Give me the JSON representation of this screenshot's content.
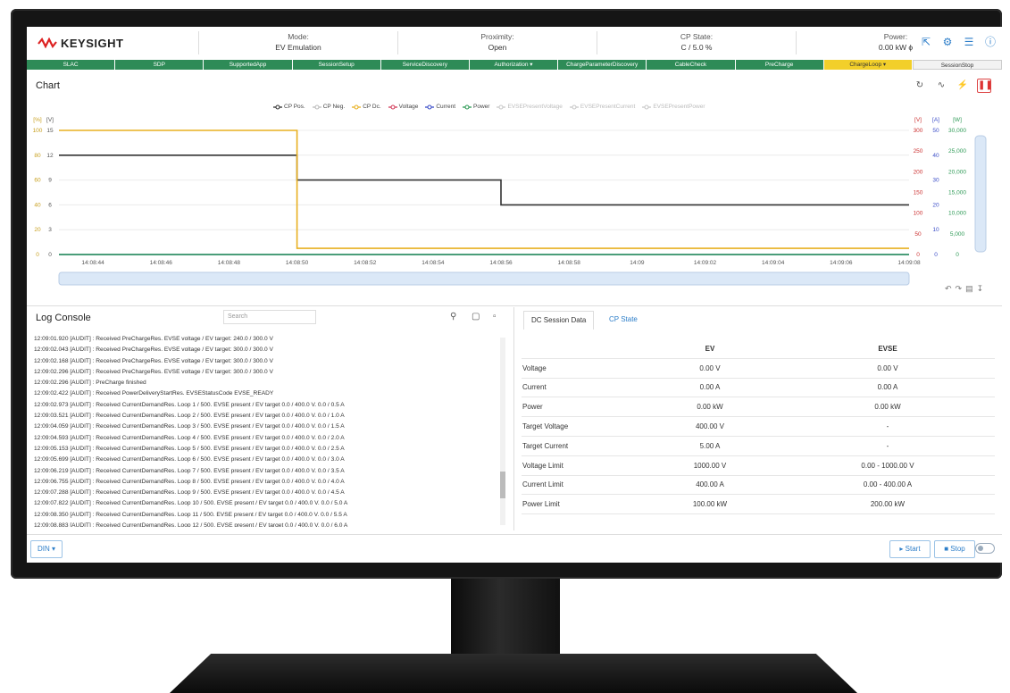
{
  "header": {
    "logo": "KEYSIGHT",
    "mode_label": "Mode:",
    "mode_value": "EV Emulation",
    "proximity_label": "Proximity:",
    "proximity_value": "Open",
    "cp_label": "CP State:",
    "cp_value": "C / 5.0 %",
    "power_label": "Power:",
    "power_value": "0.00 kW ϕ"
  },
  "steps": [
    "SLAC",
    "SDP",
    "SupportedApp",
    "SessionSetup",
    "ServiceDiscovery",
    "Authorization ▾",
    "ChargeParameterDiscovery",
    "CableCheck",
    "PreCharge",
    "ChargeLoop ▾",
    "SessionStop"
  ],
  "chart_panel": {
    "title": "Chart"
  },
  "chart_data": {
    "type": "line",
    "legend": [
      "CP Pos.",
      "CP Neg.",
      "CP Dc.",
      "Voltage",
      "Current",
      "Power",
      "EVSEPresentVoltage",
      "EVSEPresentCurrent",
      "EVSEPresentPower"
    ],
    "legend_colors": [
      "#333333",
      "#bbbbbb",
      "#e8b020",
      "#d23c5a",
      "#3c4ec8",
      "#2e9a56",
      "#c8c8c8",
      "#c8c8c8",
      "#c8c8c8"
    ],
    "left_axis_pct": [
      "100",
      "80",
      "60",
      "40",
      "20",
      "0"
    ],
    "left_axis_v": [
      "15",
      "12",
      "9",
      "6",
      "3",
      "0"
    ],
    "right_axis_v": [
      "300",
      "250",
      "200",
      "150",
      "100",
      "50",
      "0"
    ],
    "right_axis_a": [
      "50",
      "40",
      "30",
      "20",
      "10",
      "0"
    ],
    "right_axis_w": [
      "30,000",
      "25,000",
      "20,000",
      "15,000",
      "10,000",
      "5,000",
      "0"
    ],
    "axis_units": {
      "pct": "[%]",
      "v": "[V]",
      "v2": "[V]",
      "a": "[A]",
      "w": "[W]"
    },
    "x_ticks": [
      "14:08:44",
      "14:08:46",
      "14:08:48",
      "14:08:50",
      "14:08:52",
      "14:08:54",
      "14:08:56",
      "14:08:58",
      "14:09",
      "14:09:02",
      "14:09:04",
      "14:09:06",
      "14:09:08"
    ],
    "xlim": [
      "14:08:43",
      "14:09:08"
    ],
    "series": [
      {
        "name": "CP Pos.",
        "color": "#333333",
        "x": [
          "14:08:43",
          "14:08:50",
          "14:08:50",
          "14:08:56",
          "14:08:56",
          "14:09:08"
        ],
        "y": [
          12,
          12,
          9,
          9,
          6,
          6
        ]
      },
      {
        "name": "CP Dc.",
        "color": "#e8b020",
        "x": [
          "14:08:43",
          "14:08:50",
          "14:08:50",
          "14:09:08"
        ],
        "y": [
          100,
          100,
          5,
          5
        ]
      },
      {
        "name": "Current",
        "color": "#3c4ec8",
        "x": [
          "14:08:43",
          "14:09:08"
        ],
        "y": [
          0,
          0
        ]
      },
      {
        "name": "Power",
        "color": "#2e9a56",
        "x": [
          "14:08:43",
          "14:09:08"
        ],
        "y": [
          0,
          0
        ]
      }
    ]
  },
  "log": {
    "title": "Log Console",
    "search_placeholder": "Search",
    "lines": [
      "12:09:01.920 [AUDIT] : Received PreChargeRes. EVSE voltage / EV target: 240.0 / 300.0 V",
      "12:09:02.043 [AUDIT] : Received PreChargeRes. EVSE voltage / EV target: 300.0 / 300.0 V",
      "12:09:02.168 [AUDIT] : Received PreChargeRes. EVSE voltage / EV target: 300.0 / 300.0 V",
      "12:09:02.296 [AUDIT] : Received PreChargeRes. EVSE voltage / EV target: 300.0 / 300.0 V",
      "12:09:02.296 [AUDIT] : PreCharge finished",
      "12:09:02.422 [AUDIT] : Received PowerDeliveryStartRes. EVSEStatusCode EVSE_READY",
      "12:09:02.973 [AUDIT] : Received CurrentDemandRes. Loop 1 / 500. EVSE present / EV target 0.0 / 400.0 V. 0.0 / 0.5 A",
      "12:09:03.521 [AUDIT] : Received CurrentDemandRes. Loop 2 / 500. EVSE present / EV target 0.0 / 400.0 V. 0.0 / 1.0 A",
      "12:09:04.059 [AUDIT] : Received CurrentDemandRes. Loop 3 / 500. EVSE present / EV target 0.0 / 400.0 V. 0.0 / 1.5 A",
      "12:09:04.593 [AUDIT] : Received CurrentDemandRes. Loop 4 / 500. EVSE present / EV target 0.0 / 400.0 V. 0.0 / 2.0 A",
      "12:09:05.153 [AUDIT] : Received CurrentDemandRes. Loop 5 / 500. EVSE present / EV target 0.0 / 400.0 V. 0.0 / 2.5 A",
      "12:09:05.699 [AUDIT] : Received CurrentDemandRes. Loop 6 / 500. EVSE present / EV target 0.0 / 400.0 V. 0.0 / 3.0 A",
      "12:09:06.219 [AUDIT] : Received CurrentDemandRes. Loop 7 / 500. EVSE present / EV target 0.0 / 400.0 V. 0.0 / 3.5 A",
      "12:09:06.755 [AUDIT] : Received CurrentDemandRes. Loop 8 / 500. EVSE present / EV target 0.0 / 400.0 V. 0.0 / 4.0 A",
      "12:09:07.288 [AUDIT] : Received CurrentDemandRes. Loop 9 / 500. EVSE present / EV target 0.0 / 400.0 V. 0.0 / 4.5 A",
      "12:09:07.822 [AUDIT] : Received CurrentDemandRes. Loop 10 / 500. EVSE present / EV target 0.0 / 400.0 V. 0.0 / 5.0 A",
      "12:09:08.350 [AUDIT] : Received CurrentDemandRes. Loop 11 / 500. EVSE present / EV target 0.0 / 400.0 V. 0.0 / 5.5 A",
      "12:09:08.883 [AUDIT] : Received CurrentDemandRes. Loop 12 / 500. EVSE present / EV target 0.0 / 400.0 V. 0.0 / 6.0 A"
    ]
  },
  "dc": {
    "tab_session": "DC Session Data",
    "tab_cp": "CP State",
    "col_ev": "EV",
    "col_evse": "EVSE",
    "rows": [
      {
        "label": "Voltage",
        "ev": "0.00 V",
        "evse": "0.00 V"
      },
      {
        "label": "Current",
        "ev": "0.00 A",
        "evse": "0.00 A"
      },
      {
        "label": "Power",
        "ev": "0.00 kW",
        "evse": "0.00 kW"
      },
      {
        "label": "Target Voltage",
        "ev": "400.00 V",
        "evse": "-"
      },
      {
        "label": "Target Current",
        "ev": "5.00 A",
        "evse": "-"
      },
      {
        "label": "Voltage Limit",
        "ev": "1000.00 V",
        "evse": "0.00 - 1000.00 V"
      },
      {
        "label": "Current Limit",
        "ev": "400.00 A",
        "evse": "0.00 - 400.00 A"
      },
      {
        "label": "Power Limit",
        "ev": "100.00 kW",
        "evse": "200.00 kW"
      }
    ]
  },
  "footer": {
    "protocol": "DIN ▾",
    "start": "▸ Start",
    "stop": "■ Stop"
  },
  "icons": {
    "header": [
      "export-icon",
      "settings-icon",
      "sliders-icon",
      "help-icon"
    ],
    "chart": [
      "refresh-icon",
      "wave-icon",
      "bolt-icon",
      "pause-icon"
    ]
  }
}
